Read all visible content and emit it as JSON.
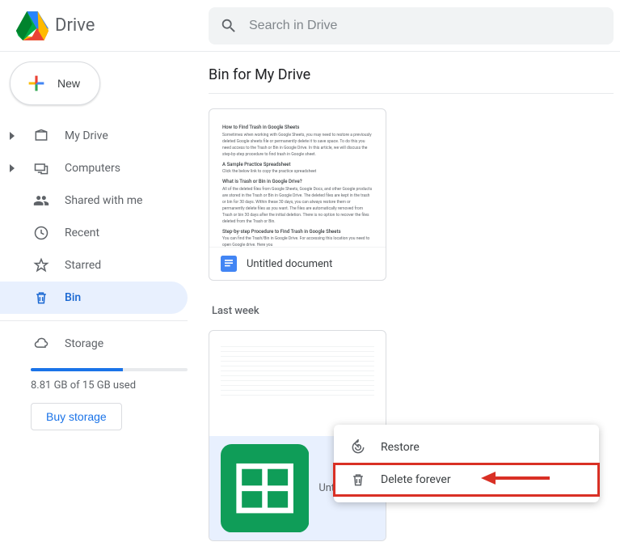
{
  "header": {
    "app_name": "Drive",
    "search_placeholder": "Search in Drive"
  },
  "sidebar": {
    "new_label": "New",
    "items": [
      {
        "label": "My Drive",
        "icon": "my-drive",
        "expandable": true
      },
      {
        "label": "Computers",
        "icon": "computers",
        "expandable": true
      },
      {
        "label": "Shared with me",
        "icon": "shared",
        "expandable": false
      },
      {
        "label": "Recent",
        "icon": "recent",
        "expandable": false
      },
      {
        "label": "Starred",
        "icon": "starred",
        "expandable": false
      },
      {
        "label": "Bin",
        "icon": "bin",
        "expandable": false,
        "selected": true
      }
    ],
    "storage_label": "Storage",
    "storage_used_text": "8.81 GB of 15 GB used",
    "storage_percent": 59,
    "buy_label": "Buy storage"
  },
  "main": {
    "title": "Bin for My Drive",
    "doc_name": "Untitled document",
    "section_label": "Last week",
    "sheet_name": "Untitled spreadsheet",
    "preview": {
      "h1": "How to Find Trash in Google Sheets",
      "p1": "Sometimes when working with Google Sheets, you may need to restore a previously deleted Google sheets file or permanently delete it to save space. To do this you need access to the Trash or Bin in Google Drive. In this article, we will discuss the step-by-step procedure to find trash in Google sheet.",
      "h2": "A Sample Practice Spreadsheet",
      "p2": "Click the below link to copy the practice spreadsheet",
      "h3": "What is Trash or Bin in Google Drive?",
      "p3": "All of the deleted files from Google Sheets, Google Docs, and other Google products are stored in the Trash or Bin in Google Drive. The deleted files are kept in the trash or bin for 30 days. Within these 30 days, you can always restore them or permanently delete files as you want. The files are automatically removed from Trash or bin 30 days after the initial deletion. There is no option to recover the files deleted from the Trash or Bin.",
      "h4": "Step-by-step Procedure to Find Trash in Google Sheets",
      "p4": "You can find the Trash/Bin in Google Drive. For accessing this location you need to open Google drive. Here you"
    }
  },
  "context_menu": {
    "restore_label": "Restore",
    "delete_label": "Delete forever"
  }
}
